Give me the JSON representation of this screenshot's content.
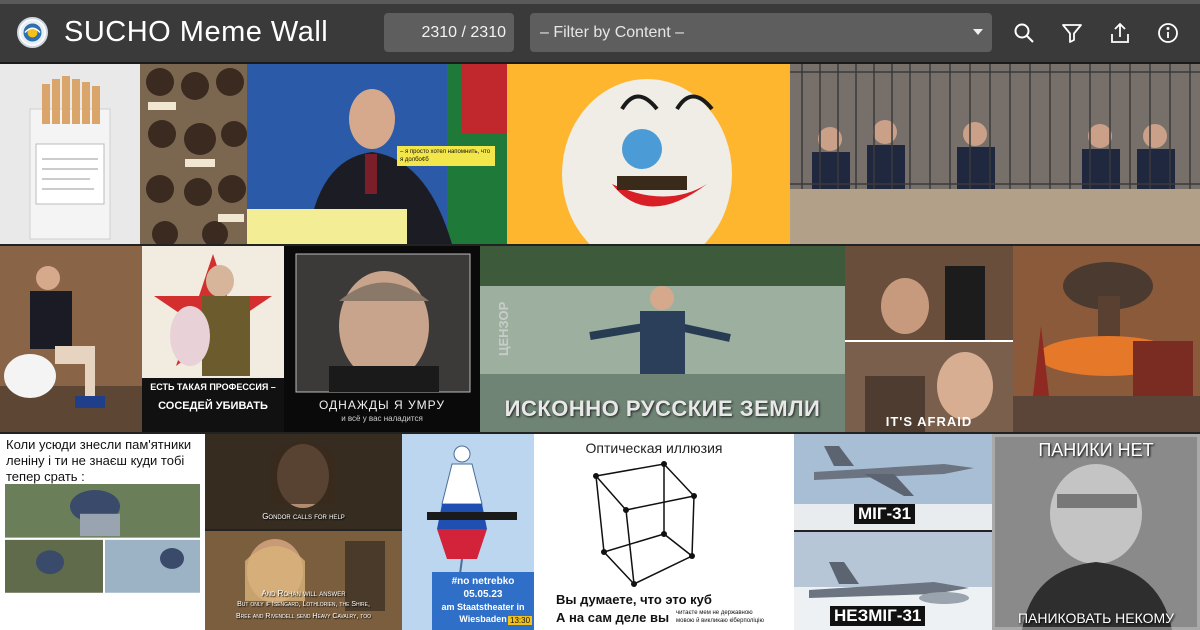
{
  "header": {
    "title": "SUCHO Meme Wall",
    "counter": "2310 / 2310",
    "filter_placeholder": "– Filter by Content –"
  },
  "icons": [
    "app-logo-icon",
    "search-icon",
    "filter-icon",
    "share-icon",
    "info-icon"
  ],
  "colors": {
    "toolbar": "#3a3a3a",
    "field": "#5e5e5e",
    "text": "#ffffff"
  },
  "memes": {
    "lukashenko_caption": "– я просто хотел напомнить, что я долбо¢б",
    "profession_line1": "ЕСТЬ ТАКАЯ ПРОФЕССИЯ –",
    "profession_line2": "СОСЕДЕЙ УБИВАТЬ",
    "die_line1": "ОДНАЖДЫ Я УМРУ",
    "die_line2": "и всё у вас наладится",
    "swamp_caption": "ИСКОННО РУССКИЕ ЗЕМЛИ",
    "swamp_watermark": "ЦЕНЗОР",
    "afraid_caption": "IT'S AFRAID",
    "monuments_text": "Коли усюди знесли пам'ятники леніну і ти не знаєш куди тобі тепер срать :",
    "gondor_caption": "Gondor calls for help",
    "rohan_line1": "And Rohan will answer",
    "rohan_line2": "But only if Isengard, Lothlorien, the Shire,",
    "rohan_line3": "Bree and Rivendell send Heavy Cavalry, too",
    "netrebko_line1": "#no netrebko",
    "netrebko_line2": "05.05.23",
    "netrebko_line3": "am Staatstheater in",
    "netrebko_line4": "Wiesbaden",
    "netrebko_time": "13:30",
    "illusion_title": "Оптическая иллюзия",
    "illusion_line1": "Вы думаете, что это куб",
    "illusion_line2": "А на сам деле вы",
    "illusion_small1": "читаєте мем не державною",
    "illusion_small2": "мовою й викликаю кіберполіцію",
    "mig_caption": "МІГ-31",
    "nezmig_caption": "НЕЗМІГ-31",
    "panic_top": "ПАНИКИ НЕТ",
    "panic_bottom": "ПАНИКОВАТЬ НЕКОМУ"
  }
}
